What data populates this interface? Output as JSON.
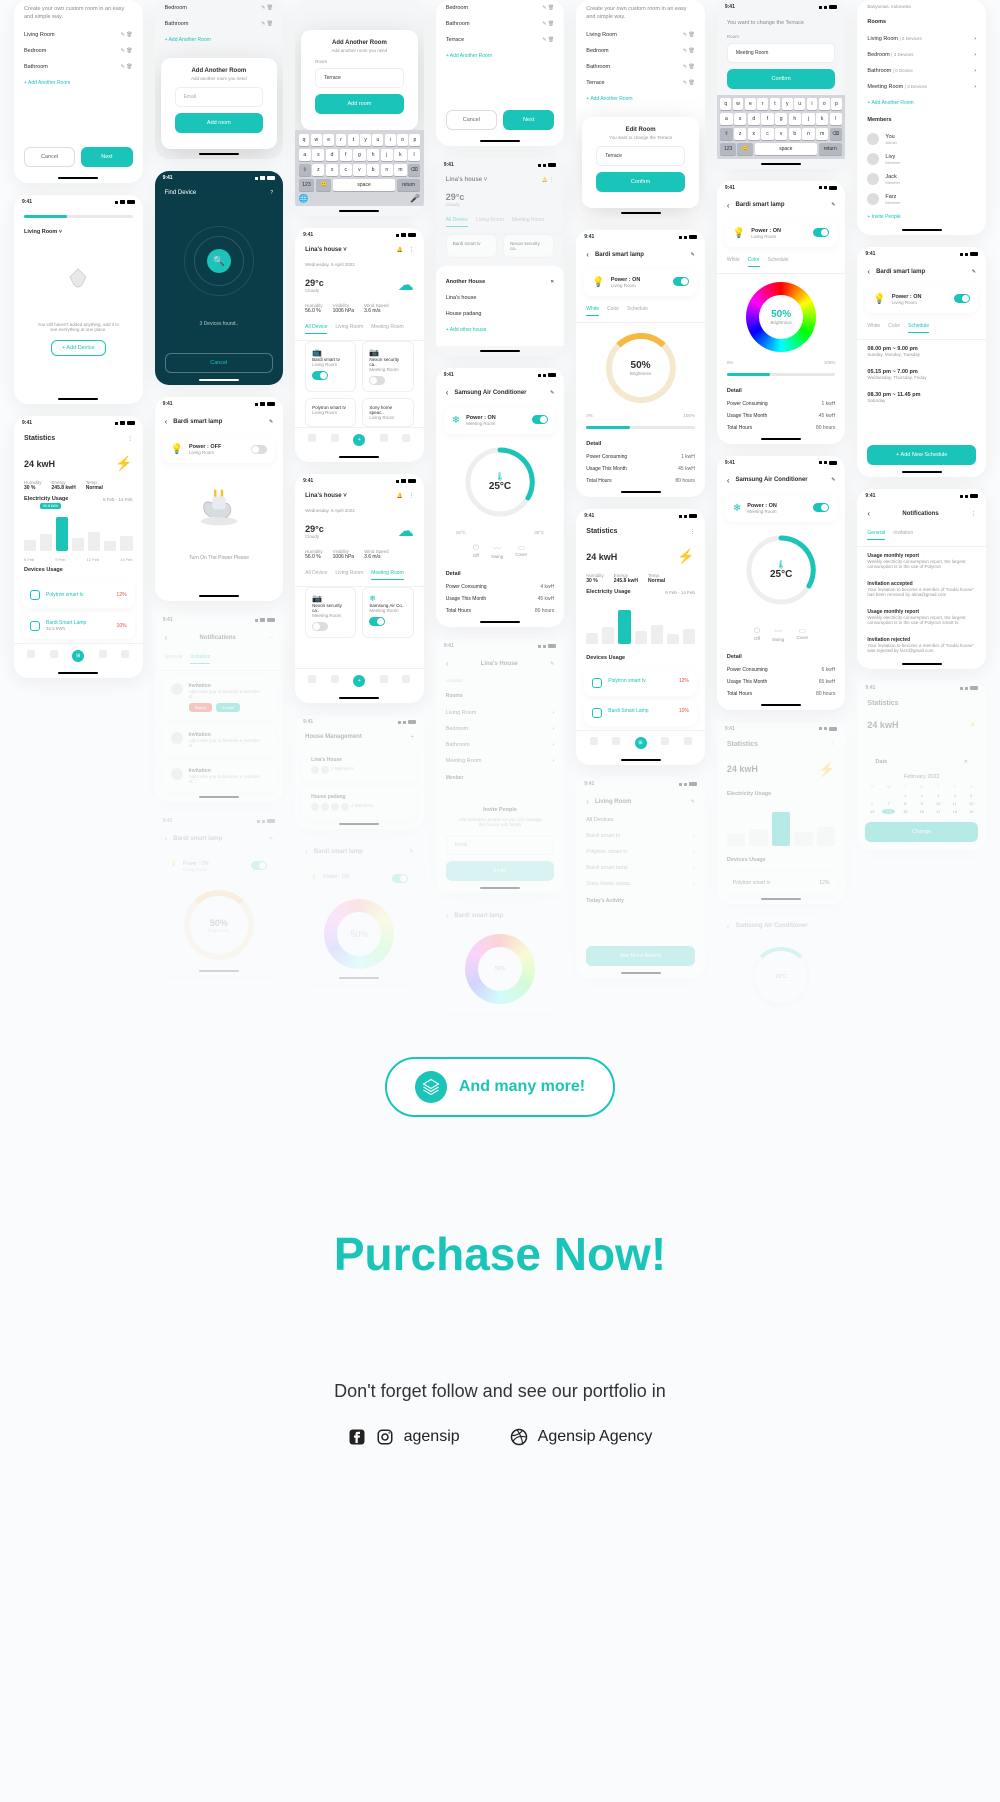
{
  "time": "9:41",
  "setup": {
    "intro": "Create your own custom room in an easy and simple way.",
    "rooms": [
      "Living Room",
      "Bedroom",
      "Bathroom",
      "Terrace",
      "Meeting Room"
    ],
    "add_link": "+  Add Another Room",
    "modal_title": "Add Another Room",
    "modal_sub": "Add another room you need",
    "edit_title": "Edit Room",
    "edit_sub": "You want to change the Terrace",
    "edit_hdr": "You want to change the Terrace",
    "placeholder_email": "Email",
    "placeholder_room": "Room",
    "val_terrace": "Terrace",
    "val_meeting": "Meeting Room",
    "btn_add": "Add room",
    "btn_cancel": "Cancel",
    "btn_next": "Next",
    "btn_confirm": "Confirm"
  },
  "find": {
    "title": "Find Device",
    "found": "3 Devices found..",
    "cancel": "Cancel"
  },
  "empty": {
    "msg": "You still haven't added anything, add it to see everything at one place.",
    "btn": "+  Add Device",
    "plug_msg": "Turn On The Power Please"
  },
  "home": {
    "house": "Lina's house",
    "date": "Wednesday, 6 April 2022",
    "temp": "29°c",
    "cond": "Cloudy",
    "hum_l": "Humidity",
    "hum_v": "56.0 %",
    "vis_l": "Visibility",
    "vis_v": "1006 hPa",
    "wind_l": "Wind Speed",
    "wind_v": "3.6 m/s",
    "tabs": [
      "All Device",
      "Living Room",
      "Meeting Room"
    ],
    "dev1": "Bardi smart tv",
    "dev1_r": "Living Room",
    "dev2": "Nexon security ca..",
    "dev2_r": "Meeting Room",
    "dev3": "Polytron smart tv",
    "dev3_r": "Living Room",
    "dev4": "Sony home speac..",
    "dev4_r": "Living Room",
    "dev5": "Samsung Air Co..",
    "dev5_r": "Meeting Room",
    "anoth": "Another House",
    "h1": "Lina's house",
    "h2": "House padang",
    "add_h": "+  Add other house"
  },
  "lamp": {
    "title": "Bardi smart lamp",
    "pwr_on": "Power : ON",
    "pwr_off": "Power : OFF",
    "room": "Living Room",
    "tabs": [
      "White",
      "Color",
      "Schedule"
    ],
    "pct": "50%",
    "pct_l": "Brightness",
    "detail": "Detail",
    "d1l": "Power Consuming",
    "d1v": "1 kwH",
    "d2l": "Usage This Month",
    "d2v": "45 kwH",
    "d3l": "Total Hours",
    "d3v": "80 hours",
    "slider_min": "0%",
    "slider_max": "100%",
    "sch_l": "Schedule",
    "sch1t": "08.00 pm ~ 9.00 pm",
    "sch1d": "Sunday, Monday, Tuesday",
    "sch2t": "05.15 pm ~ 7.00 pm",
    "sch2d": "Wednesday, Thursday, Friday",
    "sch3t": "08.30 pm ~ 11.45 pm",
    "sch3d": "Saturday",
    "add_sch": "+     Add New Schedule"
  },
  "ac": {
    "title": "Samsung Air Conditioner",
    "room": "Meeting Room",
    "temp": "25°C",
    "min": "16°C",
    "max": "30°C",
    "opts": [
      "Off",
      "Swing",
      "Cover"
    ]
  },
  "stats": {
    "title": "Statistics",
    "val": "24 kwH",
    "s1l": "Humidity",
    "s1v": "30 %",
    "s2l": "Energy",
    "s2v": "245.8 kwH",
    "s3l": "Temp",
    "s3v": "Normal",
    "eu": "Electricity Usage",
    "filter": "6 Feb - 14 Feb",
    "high": "90.8 kWh",
    "labels": [
      "6 Feb",
      "9 Feb",
      "12 Feb",
      "14 Feb"
    ],
    "du": "Devices Usage",
    "dev1": "Polytron smart tv",
    "dev1v": "12%",
    "dev2": "Bardi Smart Lamp",
    "dev2v": "10%",
    "dev2s": "32.5 kWh"
  },
  "detail": {
    "loc": "Banyumas, Indonesia",
    "rooms_h": "Rooms",
    "r1": "Living Room",
    "r1d": "| 6 Devices",
    "r2": "Bedroom",
    "r2d": "| 3 Devices",
    "r3": "Bathroom",
    "r3d": "| 0 Device",
    "r4": "Meeting Room",
    "r4d": "| 3 Devices",
    "mem_h": "Members",
    "m1": "You",
    "m1r": "Admin",
    "m2": "Livy",
    "m2r": "Member",
    "m3": "Jack",
    "m3r": "Member",
    "m4": "Farz",
    "m4r": "Member",
    "invite": "+  Invite People"
  },
  "notif": {
    "title": "Notifications",
    "tabs": [
      "General",
      "Invitation"
    ],
    "n1t": "Usage monthly report",
    "n1b": "Weekly electricity consumption report, the largest consumption is in the use of Polytron",
    "n2t": "Invitation accepted",
    "n2b": "Your invitation to become a member of \"Kedai house\" has been received by alma@gmail.com",
    "n3t": "Usage monthly report",
    "n3b": "Weekly electricity consumption report, the largest consumption is in the use of Polytron smart tv.",
    "n4t": "Invitation rejected",
    "n4b": "Your invitation to become a member of \"Kedai house\" was rejected by farzi@gmail.com",
    "inv_t": "Invitation",
    "inv_b": "Aldi invite you to become a member of..."
  },
  "mgmt": {
    "title": "House Management",
    "h1": "Lina's House",
    "h1s": "2 Members",
    "h2": "House padang",
    "h2s": "4 Members",
    "inv_t": "Invite People",
    "inv_s": "Add members people so you can manage this house with family",
    "btn": "Invite",
    "lr": "Living Room",
    "all": "All Devices",
    "today": "Today's Activity",
    "see": "See More Activity",
    "edit_h": "Lina's House",
    "edit_loc": "Location",
    "rooms_sec": "Rooms",
    "mem_sec": "Menber"
  },
  "cal": {
    "date": "Date",
    "month": "February 2022",
    "days": [
      "S",
      "M",
      "T",
      "W",
      "T",
      "F",
      "S"
    ]
  },
  "bottom": {
    "pill": "And many more!",
    "purchase": "Purchase Now!",
    "follow": "Don't forget follow and see our portfolio in",
    "soc1": "agensip",
    "soc2": "Agensip Agency"
  },
  "kb": {
    "r1": [
      "q",
      "w",
      "e",
      "r",
      "t",
      "y",
      "u",
      "i",
      "o",
      "p"
    ],
    "r2": [
      "a",
      "s",
      "d",
      "f",
      "g",
      "h",
      "j",
      "k",
      "l"
    ],
    "r3": [
      "z",
      "x",
      "c",
      "v",
      "b",
      "n",
      "m"
    ],
    "shift": "⇧",
    "del": "⌫",
    "num": "123",
    "space": "space",
    "ret": "return"
  }
}
